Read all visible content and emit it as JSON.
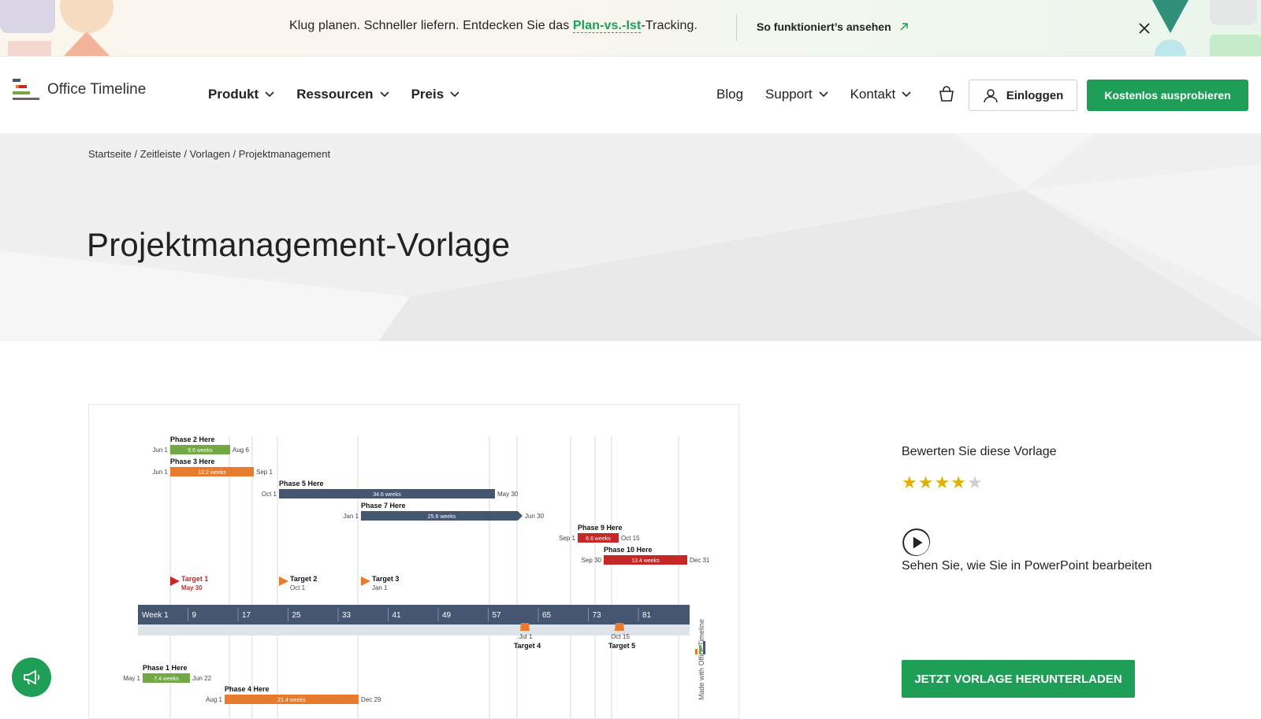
{
  "promo": {
    "text_before": "Klug planen. Schneller liefern. Entdecken Sie das ",
    "highlight": "Plan-vs.-Ist",
    "text_after": "-Tracking.",
    "link_label": "So funktioniert’s ansehen",
    "link_icon": "arrow-up-right-icon",
    "close_icon": "close-icon"
  },
  "nav": {
    "logo_text": "Office Timeline",
    "menu": [
      {
        "label": "Produkt"
      },
      {
        "label": "Ressourcen"
      },
      {
        "label": "Preis"
      }
    ],
    "links": {
      "blog": "Blog",
      "support": "Support",
      "contact": "Kontakt"
    },
    "login_label": "Einloggen",
    "trial_label": "Kostenlos ausprobieren"
  },
  "breadcrumb": "Startseite / Zeitleiste / Vorlagen / Projektmanagement",
  "page_title": "Projektmanagement-Vorlage",
  "timeline": {
    "phases_above": [
      {
        "name": "Phase 2 Here",
        "start": "Jun 1",
        "end": "Aug 6",
        "duration": "9.6 weeks",
        "color": "#72a944"
      },
      {
        "name": "Phase 3 Here",
        "start": "Jun 1",
        "end": "Sep 1",
        "duration": "13.2 weeks",
        "color": "#e97b2e"
      },
      {
        "name": "Phase 5 Here",
        "start": "Oct 1",
        "end": "May 30",
        "duration": "34.6 weeks",
        "color": "#465670"
      },
      {
        "name": "Phase 7 Here",
        "start": "Jan 1",
        "end": "Jun 30",
        "duration": "25.6 weeks",
        "color": "#465670"
      },
      {
        "name": "Phase 9 Here",
        "start": "Sep 1",
        "end": "Oct 15",
        "duration": "6.6 weeks",
        "color": "#c62828"
      },
      {
        "name": "Phase 10 Here",
        "start": "Sep 30",
        "end": "Dec 31",
        "duration": "13.4 weeks",
        "color": "#c62828"
      }
    ],
    "targets": [
      {
        "name": "Target 1",
        "date": "May 30",
        "color": "#c62828"
      },
      {
        "name": "Target 2",
        "date": "Oct 1",
        "color": "#e97b2e"
      },
      {
        "name": "Target 3",
        "date": "Jan 1",
        "color": "#e97b2e"
      }
    ],
    "axis_ticks": [
      "Week 1",
      "9",
      "17",
      "25",
      "33",
      "41",
      "49",
      "57",
      "65",
      "73",
      "81"
    ],
    "targets_below": [
      {
        "name": "Target 4",
        "date": "Jul 1"
      },
      {
        "name": "Target 5",
        "date": "Oct 15"
      }
    ],
    "phases_below": [
      {
        "name": "Phase 1 Here",
        "start": "May 1",
        "end": "Jun 22",
        "duration": "7.4 weeks",
        "color": "#72a944"
      },
      {
        "name": "Phase 4 Here",
        "start": "Aug 1",
        "end": "Dec 29",
        "duration": "21.4 weeks",
        "color": "#e97b2e"
      }
    ],
    "watermark": "Made with Office Timeline"
  },
  "side": {
    "rate_label": "Bewerten Sie diese Vorlage",
    "rating": 4,
    "rating_max": 5,
    "video_label": "Sehen Sie, wie Sie in PowerPoint bearbeiten",
    "download_label": "JETZT VORLAGE HERUNTERLADEN"
  },
  "colors": {
    "accent": "#1e9e57",
    "star": "#e0b100",
    "axis": "#465670"
  },
  "icons": {
    "feedback": "megaphone-icon",
    "cart": "shopping-bag-icon",
    "user": "user-icon",
    "play": "play-icon"
  }
}
